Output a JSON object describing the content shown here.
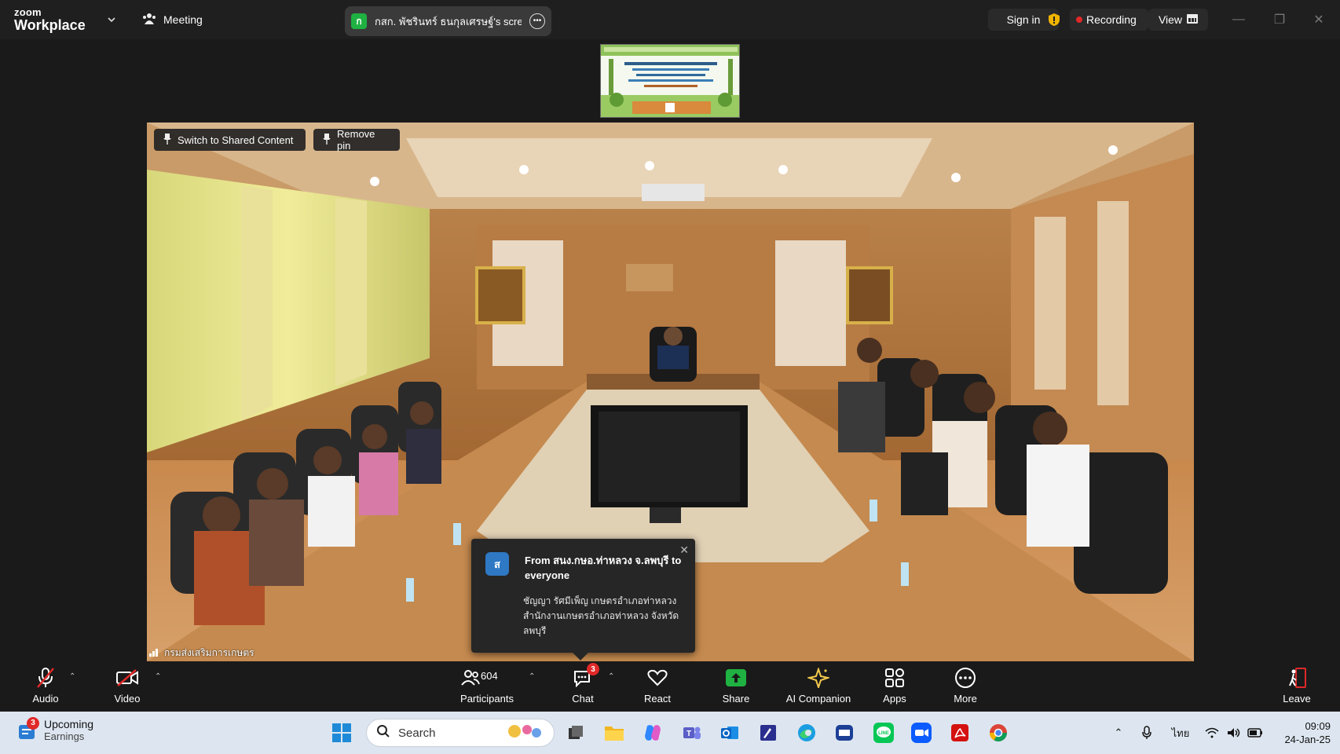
{
  "app": {
    "brand_top": "zoom",
    "brand_bottom": "Workplace",
    "meeting_label": "Meeting",
    "share_pill": {
      "initial": "ก",
      "text": "กสก. พัชรินทร์ ธนกุลเศรษฐ์'s screen"
    },
    "sign_in": "Sign in",
    "recording": "Recording",
    "view": "View"
  },
  "video": {
    "switch_label": "Switch to Shared Content",
    "remove_pin_label": "Remove pin",
    "camera_name": "กรมส่งเสริมการเกษตร"
  },
  "chat_popup": {
    "avatar_letter": "ส",
    "from": "From สนง.กษอ.ท่าหลวง จ.ลพบุรี to everyone",
    "message": "ชัญญา รัศมีเพ็ญ เกษตรอำเภอท่าหลวง สำนักงานเกษตรอำเภอท่าหลวง จังหวัดลพบุรี"
  },
  "controls": {
    "audio": "Audio",
    "video": "Video",
    "participants": "Participants",
    "participant_count": "604",
    "chat": "Chat",
    "chat_badge": "3",
    "react": "React",
    "share": "Share",
    "ai_companion": "AI Companion",
    "apps": "Apps",
    "more": "More",
    "leave": "Leave"
  },
  "taskbar": {
    "weather_badge": "3",
    "weather_title": "Upcoming",
    "weather_sub": "Earnings",
    "search_placeholder": "Search",
    "lang": "ไทย",
    "time": "09:09",
    "date": "24-Jan-25"
  },
  "colors": {
    "share_green": "#1fb141",
    "record_red": "#e02828",
    "leave_red": "#e02828"
  }
}
